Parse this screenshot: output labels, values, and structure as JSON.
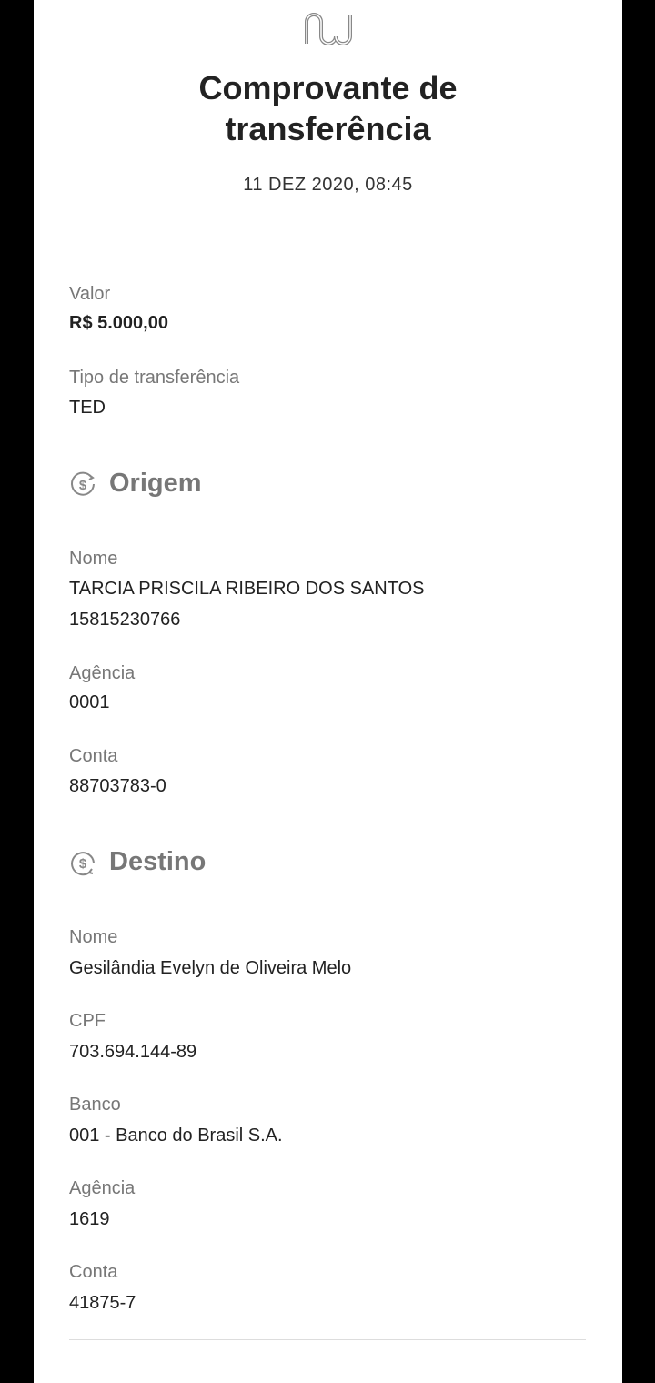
{
  "header": {
    "logo": "nu",
    "title_line1": "Comprovante de",
    "title_line2": "transferência",
    "date": "11 DEZ 2020, 08:45"
  },
  "summary": {
    "valor_label": "Valor",
    "valor": "R$ 5.000,00",
    "tipo_label": "Tipo de transferência",
    "tipo": "TED"
  },
  "origem": {
    "heading": "Origem",
    "icon": "dollar-circle-icon",
    "nome_label": "Nome",
    "nome": "TARCIA PRISCILA RIBEIRO DOS SANTOS",
    "nome_doc": "15815230766",
    "agencia_label": "Agência",
    "agencia": "0001",
    "conta_label": "Conta",
    "conta": "88703783-0"
  },
  "destino": {
    "heading": "Destino",
    "icon": "dollar-circle-icon",
    "nome_label": "Nome",
    "nome": "Gesilândia Evelyn de Oliveira Melo",
    "cpf_label": "CPF",
    "cpf": "703.694.144-89",
    "banco_label": "Banco",
    "banco": "001 - Banco do Brasil S.A.",
    "agencia_label": "Agência",
    "agencia": "1619",
    "conta_label": "Conta",
    "conta": "41875-7"
  }
}
